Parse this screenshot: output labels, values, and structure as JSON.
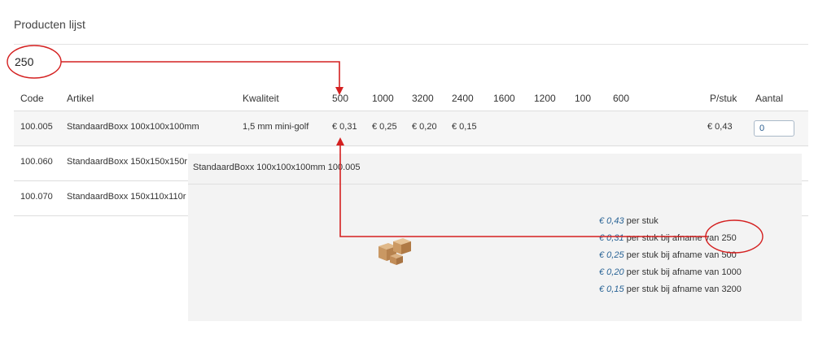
{
  "page": {
    "title": "Producten lijst"
  },
  "annotation": {
    "quantity_callout": "250"
  },
  "table": {
    "headers": [
      "Code",
      "Artikel",
      "Kwaliteit",
      "500",
      "1000",
      "3200",
      "2400",
      "1600",
      "1200",
      "100",
      "600",
      "P/stuk",
      "Aantal"
    ],
    "rows": [
      {
        "code": "100.005",
        "artikel": "StandaardBoxx 100x100x100mm",
        "kwaliteit": "1,5 mm mini-golf",
        "p500": "€ 0,31",
        "p1000": "€ 0,25",
        "p3200": "€ 0,20",
        "p2400": "€ 0,15",
        "pstuk": "€ 0,43",
        "aantal": "0"
      },
      {
        "code": "100.060",
        "artikel": "StandaardBoxx 150x150x150r"
      },
      {
        "code": "100.070",
        "artikel": "StandaardBoxx 150x110x110r"
      }
    ]
  },
  "popup": {
    "title": "StandaardBoxx 100x100x100mm 100.005",
    "product_icon": "cardboard-boxes-image",
    "prices": [
      {
        "amount": "€ 0,43",
        "text": "per stuk"
      },
      {
        "amount": "€ 0,31",
        "text": "per stuk bij afname van 250"
      },
      {
        "amount": "€ 0,25",
        "text": "per stuk bij afname van 500"
      },
      {
        "amount": "€ 0,20",
        "text": "per stuk bij afname van 1000"
      },
      {
        "amount": "€ 0,15",
        "text": "per stuk bij afname van 3200"
      }
    ]
  },
  "colors": {
    "accent_link": "#2a6496",
    "annotation_red": "#d42020",
    "popup_bg": "#f3f3f3"
  }
}
